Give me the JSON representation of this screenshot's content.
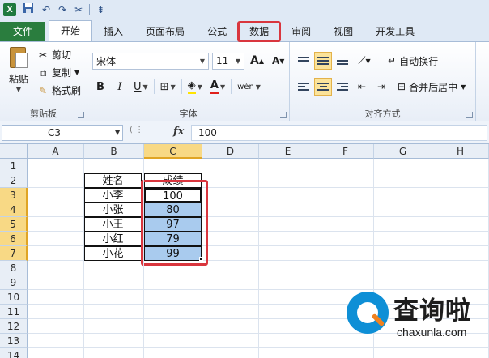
{
  "qat": {
    "app_icon": "X",
    "save_icon": "save-icon",
    "undo_label": "↶",
    "redo_label": "↷",
    "customize_label": "⇟"
  },
  "tabs": [
    {
      "label": "文件"
    },
    {
      "label": "开始"
    },
    {
      "label": "插入"
    },
    {
      "label": "页面布局"
    },
    {
      "label": "公式"
    },
    {
      "label": "数据"
    },
    {
      "label": "审阅"
    },
    {
      "label": "视图"
    },
    {
      "label": "开发工具"
    }
  ],
  "ribbon": {
    "clipboard": {
      "paste_label": "粘贴",
      "cut_label": "剪切",
      "copy_label": "复制",
      "format_painter_label": "格式刷",
      "group_label": "剪贴板"
    },
    "font": {
      "font_name": "宋体",
      "font_size": "11",
      "grow_label": "A",
      "shrink_label": "A",
      "bold_label": "B",
      "italic_label": "I",
      "underline_label": "U",
      "phonetic_label": "wén",
      "group_label": "字体"
    },
    "alignment": {
      "wrap_text_label": "自动换行",
      "merge_center_label": "合并后居中",
      "group_label": "对齐方式"
    }
  },
  "formula_bar": {
    "name_box": "C3",
    "fx_label": "fx",
    "value": "100"
  },
  "grid": {
    "columns": [
      "A",
      "B",
      "C",
      "D",
      "E",
      "F",
      "G",
      "H"
    ],
    "rows": [
      "1",
      "2",
      "3",
      "4",
      "5",
      "6",
      "7",
      "8",
      "9",
      "10",
      "11",
      "12",
      "13",
      "14"
    ],
    "selected_column": "C",
    "selected_rows": [
      "3",
      "4",
      "5",
      "6",
      "7"
    ]
  },
  "table": {
    "header_name": "姓名",
    "header_score": "成绩",
    "rows": [
      {
        "name": "小李",
        "score": "100"
      },
      {
        "name": "小张",
        "score": "80"
      },
      {
        "name": "小王",
        "score": "97"
      },
      {
        "name": "小红",
        "score": "79"
      },
      {
        "name": "小花",
        "score": "99"
      }
    ]
  },
  "watermark": {
    "brand": "查询啦",
    "url": "chaxunla.com"
  },
  "colors": {
    "file_tab": "#2a7d3e",
    "highlight_box": "#d9363e",
    "selection_fill": "#a9cbee",
    "header_selected": "#f8d985"
  }
}
